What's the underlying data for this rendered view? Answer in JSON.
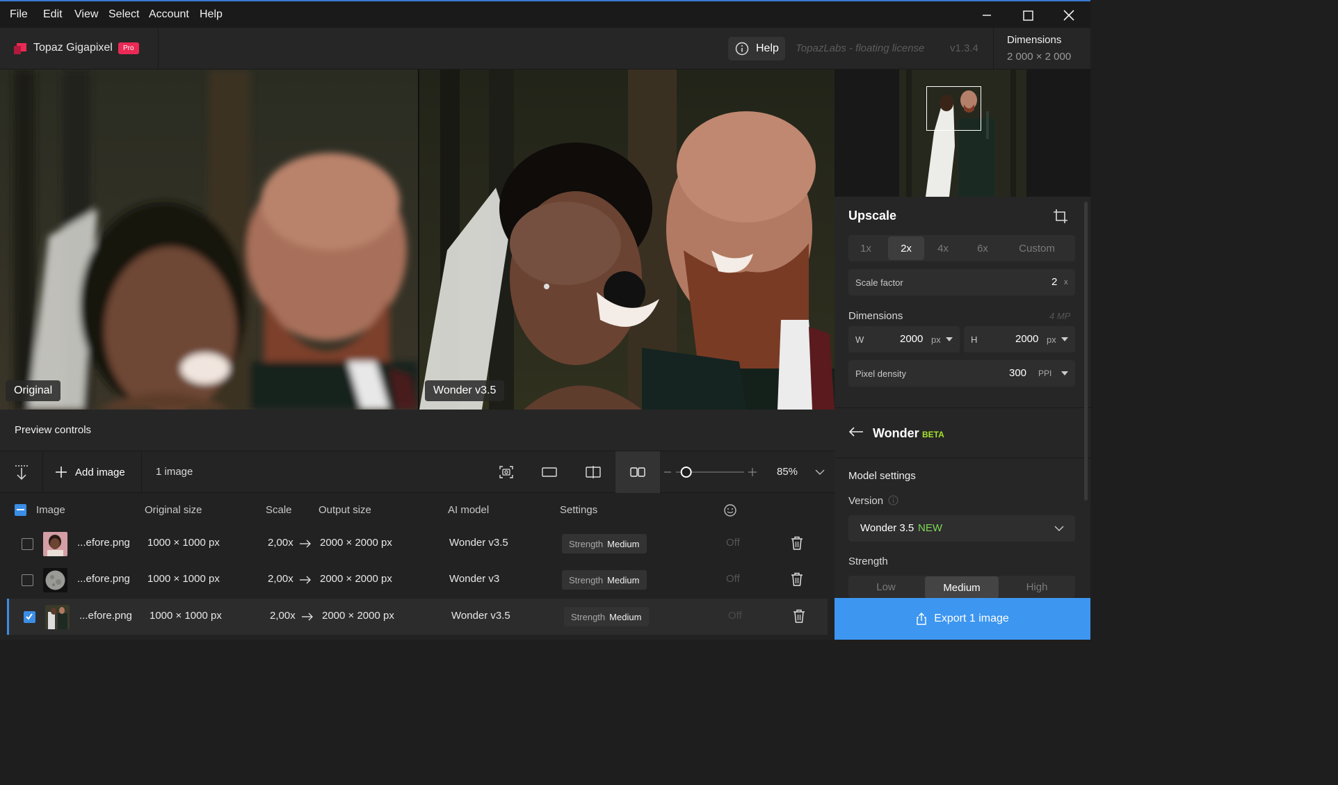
{
  "menubar": {
    "items": [
      "File",
      "Edit",
      "View",
      "Select",
      "Account",
      "Help"
    ]
  },
  "app": {
    "name": "Topaz Gigapixel",
    "tier": "Pro",
    "help_label": "Help",
    "license": "TopazLabs - floating license",
    "version": "v1.3.4",
    "dimensions_label": "Dimensions",
    "dimensions_value": "2 000 × 2 000"
  },
  "preview": {
    "left_label": "Original",
    "right_label": "Wonder v3.5"
  },
  "preview_controls": {
    "title": "Preview controls",
    "add_image": "Add image",
    "image_count": "1 image",
    "zoom": "85%",
    "zoom_slider_fraction": 0.15
  },
  "table": {
    "headers": [
      "Image",
      "Original size",
      "Scale",
      "Output size",
      "AI model",
      "Settings"
    ],
    "rows": [
      {
        "name": "...efore.png",
        "original": "1000 × 1000 px",
        "scale": "2,00x",
        "output": "2000 × 2000 px",
        "model": "Wonder v3.5",
        "setting_key": "Strength",
        "setting_val": "Medium",
        "face": "Off",
        "checked": false
      },
      {
        "name": "...efore.png",
        "original": "1000 × 1000 px",
        "scale": "2,00x",
        "output": "2000 × 2000 px",
        "model": "Wonder v3",
        "setting_key": "Strength",
        "setting_val": "Medium",
        "face": "Off",
        "checked": false
      },
      {
        "name": "...efore.png",
        "original": "1000 × 1000 px",
        "scale": "2,00x",
        "output": "2000 × 2000 px",
        "model": "Wonder v3.5",
        "setting_key": "Strength",
        "setting_val": "Medium",
        "face": "Off",
        "checked": true
      }
    ]
  },
  "panel": {
    "upscale_title": "Upscale",
    "scale_options": [
      "1x",
      "2x",
      "4x",
      "6x",
      "Custom"
    ],
    "scale_selected": "2x",
    "scale_factor_label": "Scale factor",
    "scale_factor_value": "2",
    "scale_factor_unit": "x",
    "dimensions_label": "Dimensions",
    "megapixels": "4 MP",
    "w_label": "W",
    "w_value": "2000",
    "w_unit": "px",
    "h_label": "H",
    "h_value": "2000",
    "h_unit": "px",
    "density_label": "Pixel density",
    "density_value": "300",
    "density_unit": "PPI",
    "model_title": "Wonder",
    "model_badge": "BETA",
    "model_settings": "Model settings",
    "version_label": "Version",
    "version_value": "Wonder 3.5",
    "version_badge": "NEW",
    "strength_label": "Strength",
    "strength_options": [
      "Low",
      "Medium",
      "High"
    ],
    "strength_selected": "Medium",
    "export_label": "Export 1 image"
  },
  "colors": {
    "accent_blue": "#3d96f0",
    "pro_red": "#ea2a55",
    "beta_green": "#a6e22e",
    "new_green": "#7ed957"
  }
}
